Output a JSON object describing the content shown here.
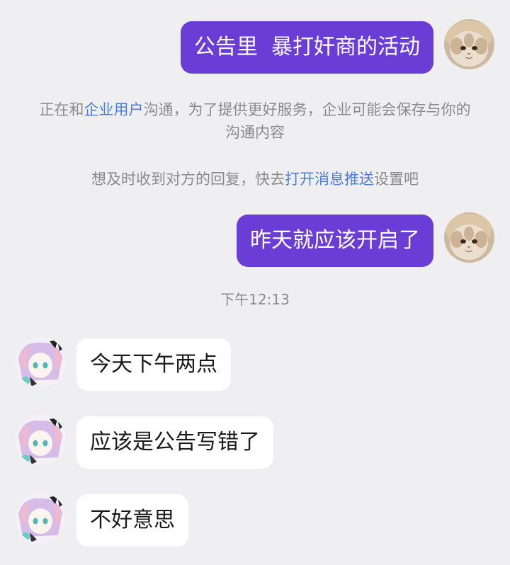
{
  "colors": {
    "background": "#efeff1",
    "outgoing_bubble": "#6b3dd7",
    "incoming_bubble": "#ffffff",
    "link": "#4b80d6",
    "muted_text": "#8a8a8a"
  },
  "chat": {
    "items": [
      {
        "type": "outgoing",
        "text": "公告里  暴打奸商的活动",
        "avatar": "cat-avatar"
      },
      {
        "type": "system",
        "segments": [
          {
            "text": "正在和",
            "link": false
          },
          {
            "text": "企业用户",
            "link": true
          },
          {
            "text": "沟通，为了提供更好服务，企业可能会保存与你的沟通内容",
            "link": false
          }
        ]
      },
      {
        "type": "system",
        "segments": [
          {
            "text": "想及时收到对方的回复，快去",
            "link": false
          },
          {
            "text": "打开消息推送",
            "link": true
          },
          {
            "text": "设置吧",
            "link": false
          }
        ]
      },
      {
        "type": "outgoing",
        "text": "昨天就应该开启了",
        "avatar": "cat-avatar"
      },
      {
        "type": "timestamp",
        "text": "下午12:13"
      },
      {
        "type": "incoming",
        "text": "今天下午两点",
        "avatar": "contact-avatar"
      },
      {
        "type": "incoming",
        "text": "应该是公告写错了",
        "avatar": "contact-avatar"
      },
      {
        "type": "incoming",
        "text": "不好意思",
        "avatar": "contact-avatar"
      }
    ]
  }
}
